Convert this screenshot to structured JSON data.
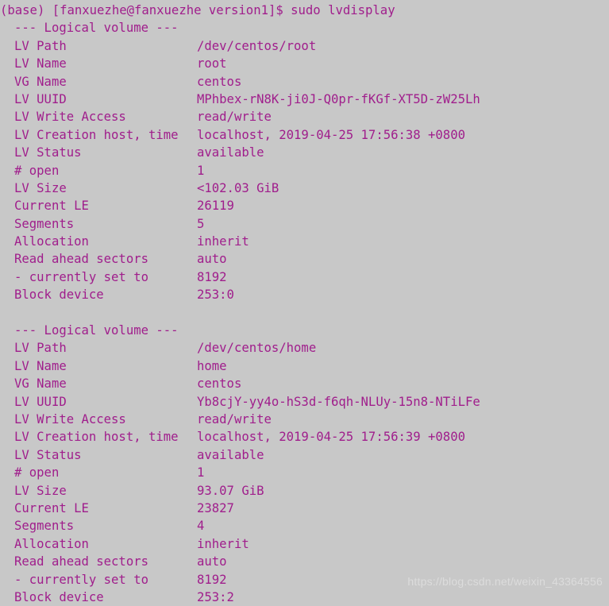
{
  "terminal": {
    "background_color": "#c8c8c8",
    "text_color": "#a01e8c",
    "prompt_line": "(base) [fanxuezhe@fanxuezhe version1]$ sudo lvdisplay",
    "command": "sudo lvdisplay",
    "user": "fanxuezhe",
    "host": "fanxuezhe",
    "cwd": "version1",
    "env_prefix": "(base)"
  },
  "section_header": "--- Logical volume ---",
  "volumes": [
    {
      "header": "--- Logical volume ---",
      "fields": [
        {
          "key": "LV Path",
          "value": "/dev/centos/root"
        },
        {
          "key": "LV Name",
          "value": "root"
        },
        {
          "key": "VG Name",
          "value": "centos"
        },
        {
          "key": "LV UUID",
          "value": "MPhbex-rN8K-ji0J-Q0pr-fKGf-XT5D-zW25Lh"
        },
        {
          "key": "LV Write Access",
          "value": "read/write"
        },
        {
          "key": "LV Creation host, time",
          "value": "localhost, 2019-04-25 17:56:38 +0800"
        },
        {
          "key": "LV Status",
          "value": "available"
        },
        {
          "key": "# open",
          "value": "1"
        },
        {
          "key": "LV Size",
          "value": "<102.03 GiB"
        },
        {
          "key": "Current LE",
          "value": "26119"
        },
        {
          "key": "Segments",
          "value": "5"
        },
        {
          "key": "Allocation",
          "value": "inherit"
        },
        {
          "key": "Read ahead sectors",
          "value": "auto"
        },
        {
          "key": "- currently set to",
          "value": "8192"
        },
        {
          "key": "Block device",
          "value": "253:0"
        }
      ]
    },
    {
      "header": "--- Logical volume ---",
      "fields": [
        {
          "key": "LV Path",
          "value": "/dev/centos/home"
        },
        {
          "key": "LV Name",
          "value": "home"
        },
        {
          "key": "VG Name",
          "value": "centos"
        },
        {
          "key": "LV UUID",
          "value": "Yb8cjY-yy4o-hS3d-f6qh-NLUy-15n8-NTiLFe"
        },
        {
          "key": "LV Write Access",
          "value": "read/write"
        },
        {
          "key": "LV Creation host, time",
          "value": "localhost, 2019-04-25 17:56:39 +0800"
        },
        {
          "key": "LV Status",
          "value": "available"
        },
        {
          "key": "# open",
          "value": "1"
        },
        {
          "key": "LV Size",
          "value": "93.07 GiB"
        },
        {
          "key": "Current LE",
          "value": "23827"
        },
        {
          "key": "Segments",
          "value": "4"
        },
        {
          "key": "Allocation",
          "value": "inherit"
        },
        {
          "key": "Read ahead sectors",
          "value": "auto"
        },
        {
          "key": "- currently set to",
          "value": "8192"
        },
        {
          "key": "Block device",
          "value": "253:2"
        }
      ]
    }
  ],
  "watermark": "https://blog.csdn.net/weixin_43364556"
}
